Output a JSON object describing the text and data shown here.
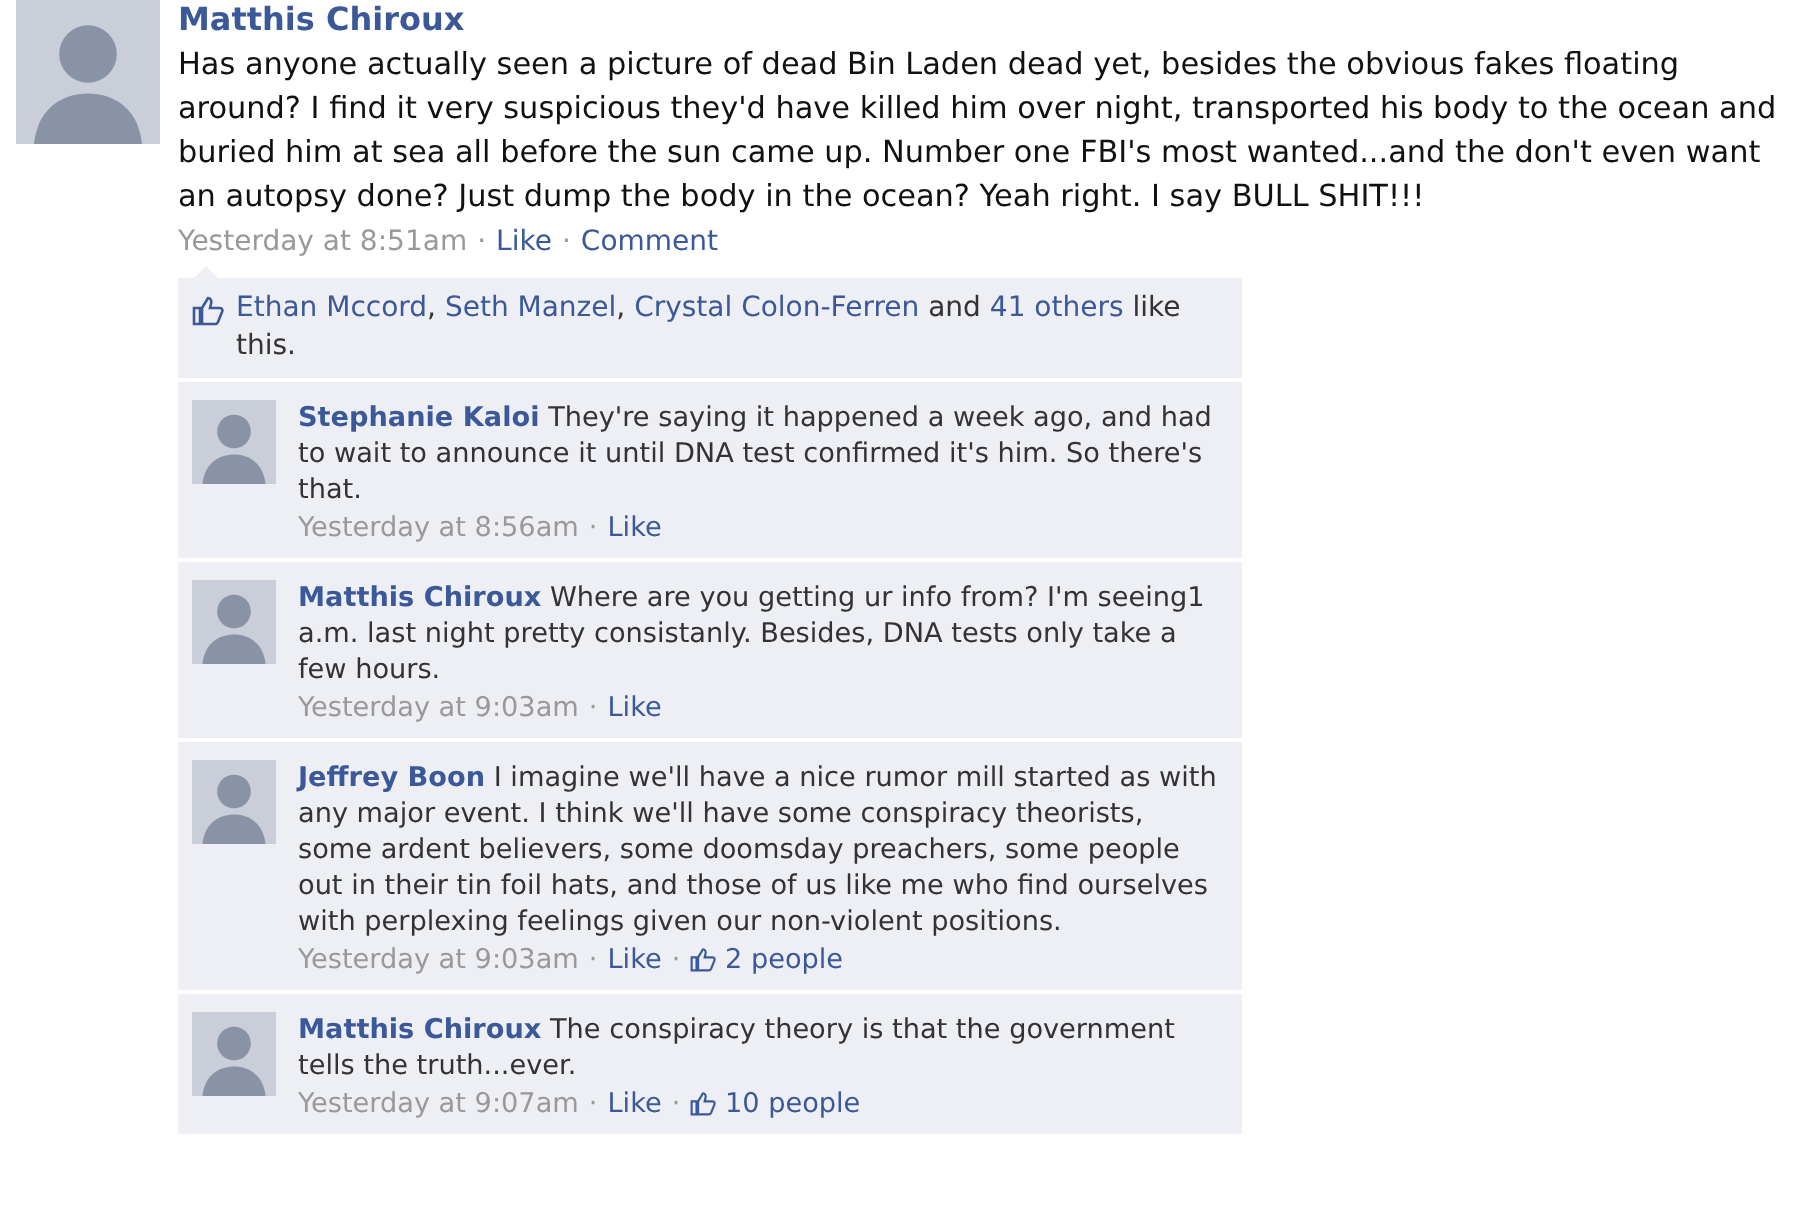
{
  "post": {
    "author": "Matthis Chiroux",
    "text": "Has anyone actually seen a picture of dead Bin Laden dead yet, besides the obvious fakes floating around? I find it very suspicious they'd have killed him over night, transported his body to the ocean and buried him at sea all before the sun came up. Number one FBI's most wanted...and the don't even want an autopsy done? Just dump the body in the ocean? Yeah right. I say BULL SHIT!!!",
    "meta": [
      {
        "kind": "time",
        "text": "Yesterday at 8:51am"
      },
      {
        "kind": "sep",
        "text": "·"
      },
      {
        "kind": "link",
        "text": "Like"
      },
      {
        "kind": "sep",
        "text": "·"
      },
      {
        "kind": "link",
        "text": "Comment"
      }
    ]
  },
  "likes": [
    {
      "kind": "link",
      "text": "Ethan Mccord"
    },
    {
      "kind": "text",
      "text": ", "
    },
    {
      "kind": "link",
      "text": "Seth Manzel"
    },
    {
      "kind": "text",
      "text": ", "
    },
    {
      "kind": "link",
      "text": "Crystal Colon-Ferren"
    },
    {
      "kind": "text",
      "text": " and "
    },
    {
      "kind": "link",
      "text": "41 others"
    },
    {
      "kind": "text",
      "text": " like this."
    }
  ],
  "comments": [
    {
      "author": "Stephanie Kaloi",
      "text": "They're saying it happened a week ago, and had to wait to announce it until DNA test confirmed it's him. So there's that.",
      "meta": [
        {
          "kind": "time",
          "text": "Yesterday at 8:56am"
        },
        {
          "kind": "sep",
          "text": "·"
        },
        {
          "kind": "link",
          "text": "Like"
        }
      ]
    },
    {
      "author": "Matthis Chiroux",
      "text": "Where are you getting ur info from? I'm seeing1 a.m. last night pretty consistanly. Besides, DNA tests only take a few hours.",
      "meta": [
        {
          "kind": "time",
          "text": "Yesterday at 9:03am"
        },
        {
          "kind": "sep",
          "text": "·"
        },
        {
          "kind": "link",
          "text": "Like"
        }
      ]
    },
    {
      "author": "Jeffrey Boon",
      "text": "I imagine we'll have a nice rumor mill started as with any major event. I think we'll have some conspiracy theorists, some ardent believers, some doomsday preachers, some people out in their tin foil hats, and those of us like me who find ourselves with perplexing feelings given our non-violent positions.",
      "meta": [
        {
          "kind": "time",
          "text": "Yesterday at 9:03am"
        },
        {
          "kind": "sep",
          "text": "·"
        },
        {
          "kind": "link",
          "text": "Like"
        },
        {
          "kind": "sep",
          "text": "·"
        },
        {
          "kind": "likes",
          "text": "2 people"
        }
      ]
    },
    {
      "author": "Matthis Chiroux",
      "text": "The conspiracy theory is that the government tells the truth...ever.",
      "meta": [
        {
          "kind": "time",
          "text": "Yesterday at 9:07am"
        },
        {
          "kind": "sep",
          "text": "·"
        },
        {
          "kind": "link",
          "text": "Like"
        },
        {
          "kind": "sep",
          "text": "·"
        },
        {
          "kind": "likes",
          "text": "10 people"
        }
      ]
    }
  ]
}
